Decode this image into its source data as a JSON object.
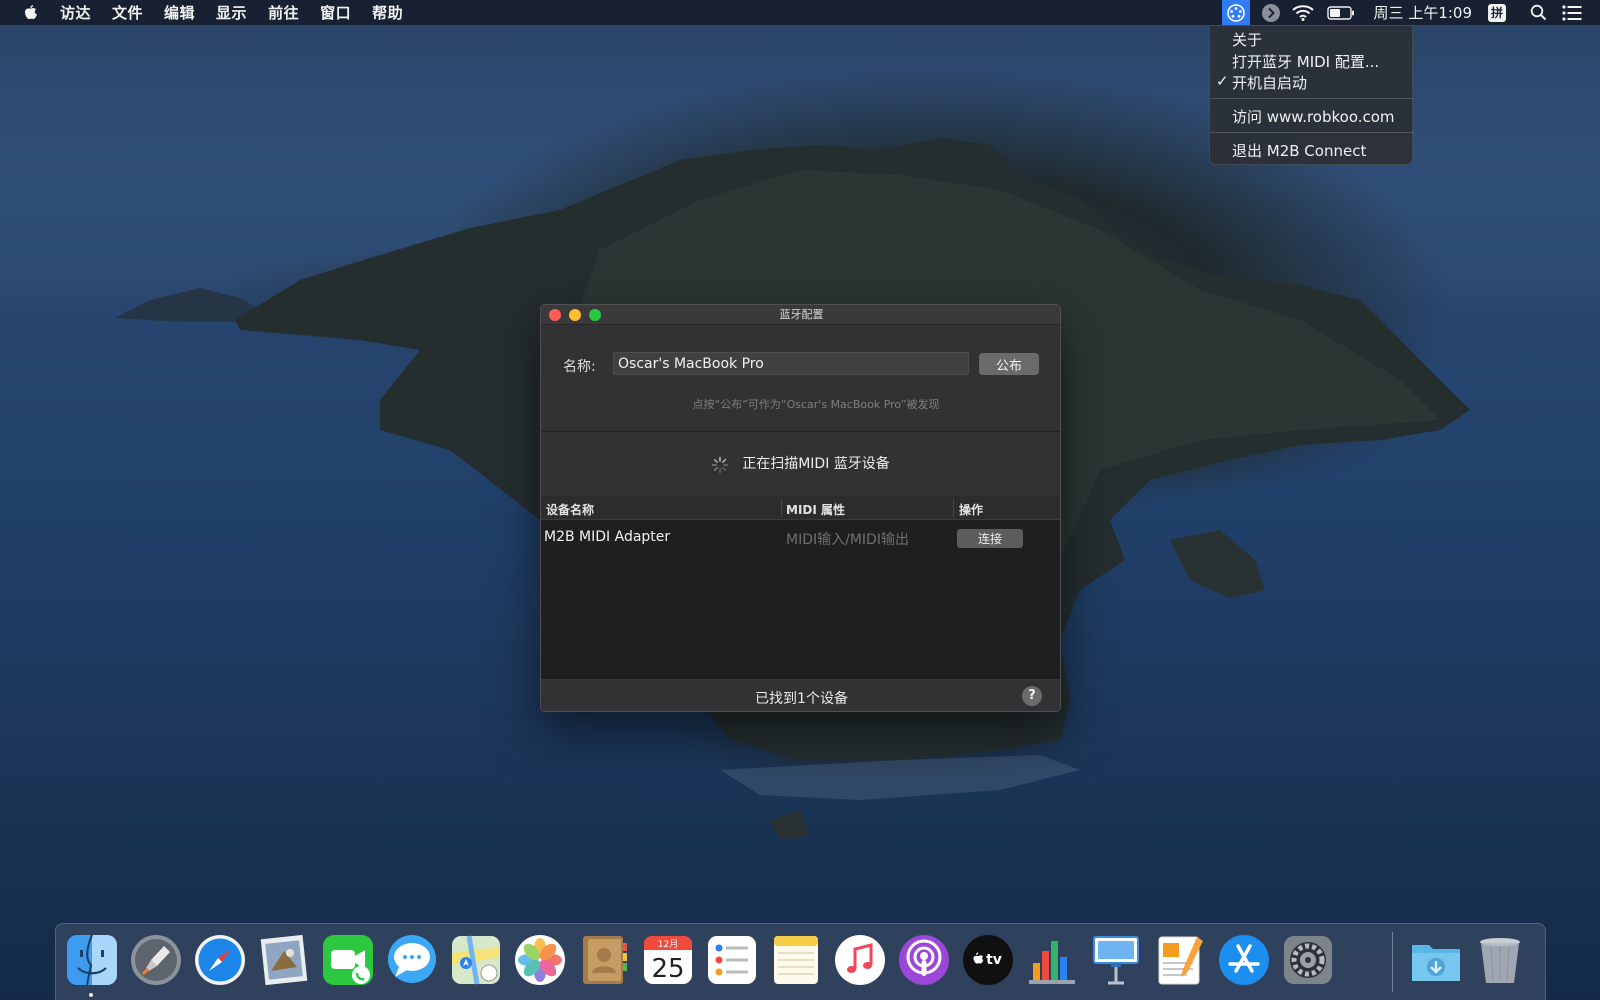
{
  "menubar": {
    "items": [
      "访达",
      "文件",
      "编辑",
      "显示",
      "前往",
      "窗口",
      "帮助"
    ],
    "clock": "周三 上午1:09",
    "input_method": "拼"
  },
  "status_menu": {
    "about": "关于",
    "open_config": "打开蓝牙 MIDI 配置...",
    "launch_at_login": "开机自启动",
    "launch_at_login_checked": true,
    "check_mark": "✓",
    "visit": "访问 www.robkoo.com",
    "quit": "退出 M2B Connect"
  },
  "window": {
    "title": "蓝牙配置",
    "name_label": "名称:",
    "name_value": "Oscar's MacBook Pro",
    "publish_button": "公布",
    "hint": "点按“公布”可作为“Oscar's MacBook Pro”被发现",
    "scanning_text": "正在扫描MIDI 蓝牙设备",
    "table": {
      "columns": [
        "设备名称",
        "MIDI 属性",
        "操作"
      ],
      "rows": [
        {
          "device": "M2B MIDI Adapter",
          "midi": "MIDI输入/MIDI输出",
          "action": "连接"
        }
      ]
    },
    "footer_text": "已找到1个设备",
    "help": "?"
  },
  "calendar": {
    "month": "12月",
    "day": "25"
  },
  "dock": {
    "icons": [
      "finder-icon",
      "launchpad-icon",
      "safari-icon",
      "mail-icon",
      "facetime-icon",
      "messages-icon",
      "maps-icon",
      "photos-icon",
      "contacts-icon",
      "calendar-icon",
      "reminders-icon",
      "notes-icon",
      "music-icon",
      "podcasts-icon",
      "apple-tv-icon",
      "numbers-icon",
      "keynote-icon",
      "pages-icon",
      "app-store-icon",
      "system-preferences-icon",
      "downloads-folder-icon",
      "trash-icon"
    ],
    "apple_tv_label": "tv"
  },
  "colors": {
    "menubar": "#161e2e",
    "window_bg": "#323234",
    "table_bg": "#1f1f21",
    "close": "#fd5f57",
    "minimize": "#febc2e",
    "zoom": "#28c840",
    "app_status_icon": "#2f7cf6"
  }
}
